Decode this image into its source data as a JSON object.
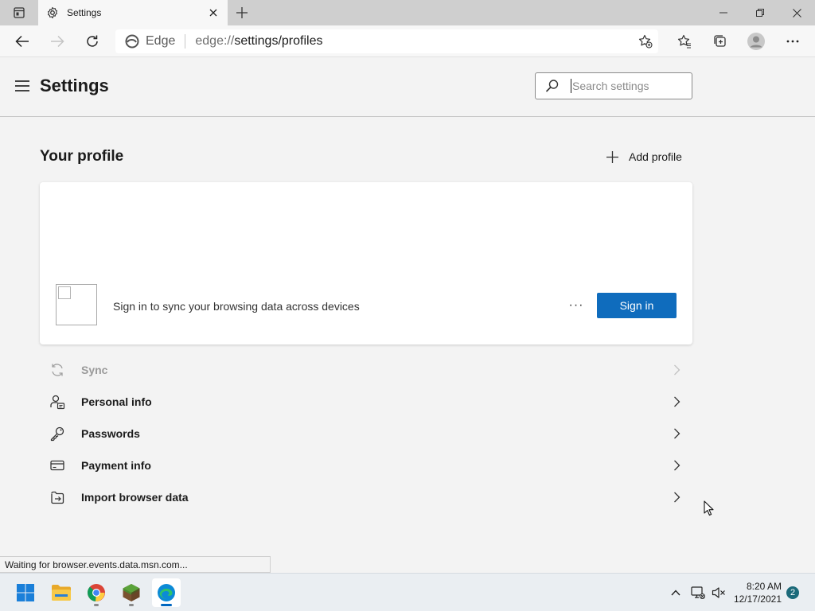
{
  "browser": {
    "tab": {
      "title": "Settings"
    },
    "address": {
      "site_label": "Edge",
      "url_prefix": "edge://",
      "url_rest": "settings/profiles"
    }
  },
  "settings": {
    "title": "Settings",
    "search": {
      "placeholder": "Search settings",
      "value": ""
    }
  },
  "profile": {
    "section_title": "Your profile",
    "add_profile_label": "Add profile",
    "sync_text": "Sign in to sync your browsing data across devices",
    "more_label": "···",
    "sign_in_label": "Sign in",
    "items": [
      {
        "label": "Sync",
        "icon": "sync-icon",
        "enabled": false
      },
      {
        "label": "Personal info",
        "icon": "personal-info-icon",
        "enabled": true
      },
      {
        "label": "Passwords",
        "icon": "key-icon",
        "enabled": true
      },
      {
        "label": "Payment info",
        "icon": "credit-card-icon",
        "enabled": true
      },
      {
        "label": "Import browser data",
        "icon": "import-icon",
        "enabled": true
      }
    ]
  },
  "status_text": "Waiting for browser.events.data.msn.com...",
  "taskbar": {
    "apps": [
      "windows-start-icon",
      "file-explorer-icon",
      "chrome-icon",
      "minecraft-icon",
      "edge-icon"
    ],
    "clock": {
      "time": "8:20 AM",
      "date": "12/17/2021"
    },
    "notification_count": "2"
  },
  "colors": {
    "accent": "#0f6cbd",
    "background": "#f3f3f3",
    "card": "#ffffff"
  }
}
